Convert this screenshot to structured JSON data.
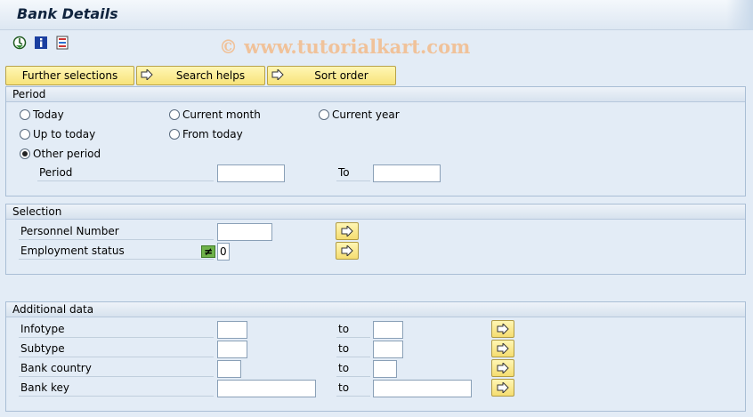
{
  "title": "Bank Details",
  "watermark": "© www.tutorialkart.com",
  "toolbar_icons": [
    "execute-icon",
    "info-icon",
    "selection-options-icon"
  ],
  "buttons": {
    "further_selections": "Further selections",
    "search_helps": "Search helps",
    "sort_order": "Sort order"
  },
  "period": {
    "header": "Period",
    "radios": {
      "today": "Today",
      "current_month": "Current month",
      "current_year": "Current year",
      "up_to_today": "Up to today",
      "from_today": "From today",
      "other_period": "Other period"
    },
    "selected": "other_period",
    "period_label": "Period",
    "to_label": "To",
    "from_value": "",
    "to_value": ""
  },
  "selection": {
    "header": "Selection",
    "personnel_number_label": "Personnel Number",
    "personnel_number_value": "",
    "employment_status_label": "Employment status",
    "employment_status_value": "0",
    "employment_status_option": "≠"
  },
  "additional": {
    "header": "Additional data",
    "to_label": "to",
    "rows": {
      "infotype": "Infotype",
      "subtype": "Subtype",
      "bank_country": "Bank country",
      "bank_key": "Bank key"
    }
  },
  "colors": {
    "accent_button": "#f7e37a",
    "background": "#e3ecf6",
    "option_icon": "#6fb24a"
  }
}
